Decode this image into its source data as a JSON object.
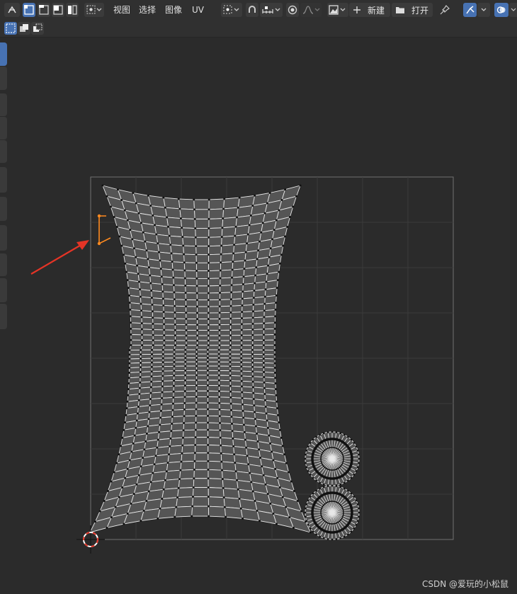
{
  "header": {
    "menus": [
      "视图",
      "选择",
      "图像",
      "UV"
    ],
    "new_label": "新建",
    "open_label": "打开",
    "icons": [
      "editor-type-icon",
      "vertex-select-icon",
      "edge-select-icon",
      "face-select-icon",
      "island-select-icon",
      "sticky-select-icon",
      "pivot-icon",
      "snap-icon",
      "snap-target-icon",
      "proportional-edit-icon",
      "falloff-icon",
      "image-browse-icon",
      "plus-icon",
      "folder-icon",
      "pin-icon",
      "uv-sync-icon",
      "overlay-icon"
    ]
  },
  "subbar": {
    "icons": [
      "select-box-icon",
      "select-extend-icon",
      "select-subtract-icon"
    ]
  },
  "toolbar": {
    "active_tool": "tweak-tool",
    "tools": [
      "tweak-tool",
      "cursor-tool",
      "move-tool",
      "rotate-tool",
      "scale-tool",
      "transform-tool",
      "annotate-tool",
      "grab-tool",
      "pinch-tool",
      "relax-tool",
      "rip-tool"
    ]
  },
  "viewport": {
    "grid_divisions": 8,
    "colors": {
      "background": "#2b2b2b",
      "uv_face": "#555555",
      "uv_edge": "#e8e8e8",
      "uv_vertex": "#111111",
      "selected": "#ff8a1f",
      "arrow": "#e53426",
      "grid_line": "#3b3b3b",
      "cursor": "#e53426"
    },
    "selected_edge_label": ""
  },
  "watermark": "CSDN @爱玩的小松鼠"
}
